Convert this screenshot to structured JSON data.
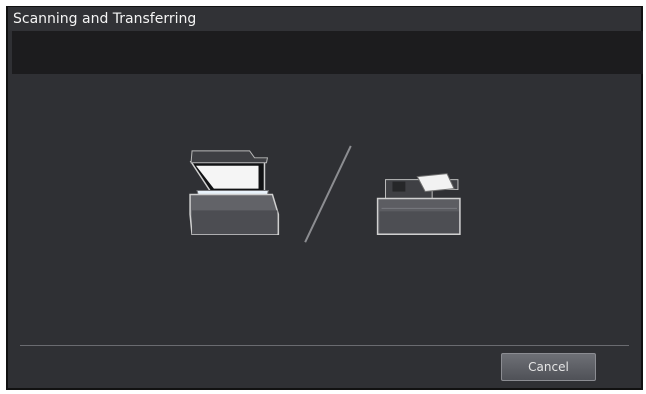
{
  "window": {
    "title": "Scanning and Transferring",
    "message": ""
  },
  "illustration": {
    "left_device": "flatbed-scanner-icon",
    "separator": "slash",
    "right_device": "document-feeder-scanner-icon"
  },
  "footer": {
    "cancel_label": "Cancel"
  },
  "colors": {
    "background": "#2f3034",
    "message_bar": "#1c1c1e",
    "button": "#5f6167",
    "text": "#f4f4f4"
  }
}
